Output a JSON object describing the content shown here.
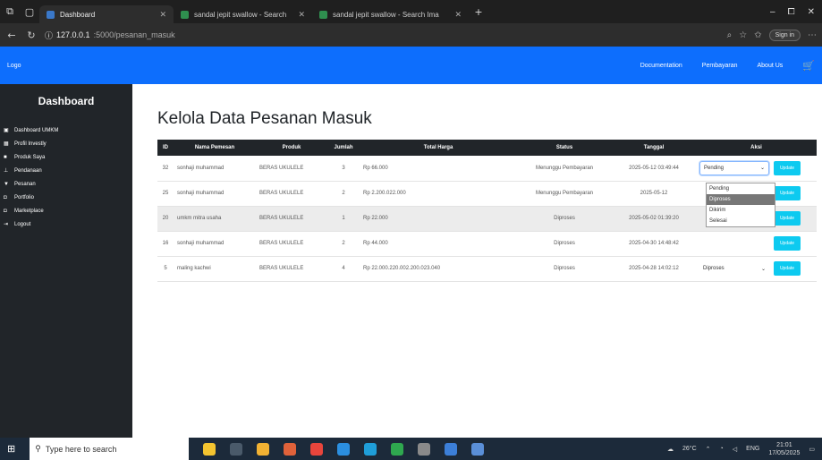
{
  "browser": {
    "tabs": [
      {
        "label": "Dashboard",
        "active": true
      },
      {
        "label": "sandal jepit swallow - Search",
        "active": false
      },
      {
        "label": "sandal jepit swallow - Search Ima",
        "active": false
      }
    ],
    "new_tab": "+",
    "url_host": "127.0.0.1",
    "url_path": ":5000/pesanan_masuk",
    "signin_label": "Sign in"
  },
  "navbar": {
    "brand": "Logo",
    "links": [
      "Documentation",
      "Pembayaran",
      "About Us"
    ]
  },
  "sidebar": {
    "title": "Dashboard",
    "items": [
      {
        "icon": "▣",
        "label": "Dashboard UMKM"
      },
      {
        "icon": "▦",
        "label": "Profil Investly"
      },
      {
        "icon": "■",
        "label": "Produk Saya"
      },
      {
        "icon": "⊥",
        "label": "Pendanaan"
      },
      {
        "icon": "▼",
        "label": "Pesanan"
      },
      {
        "icon": "◘",
        "label": "Portfolio"
      },
      {
        "icon": "◘",
        "label": "Marketplace"
      },
      {
        "icon": "⇥",
        "label": "Logout"
      }
    ]
  },
  "page": {
    "title": "Kelola Data Pesanan Masuk",
    "columns": [
      "ID",
      "Nama Pemesan",
      "Produk",
      "Jumlah",
      "Total Harga",
      "Status",
      "Tanggal",
      "Aksi"
    ],
    "rows": [
      {
        "id": "32",
        "nama": "sonhaji muhammad",
        "produk": "BERAS UKULELE",
        "jumlah": "3",
        "harga": "Rp 66.000",
        "status": "Menunggu Pembayaran",
        "tanggal": "2025-05-12 03:49:44",
        "aksi": "Pending"
      },
      {
        "id": "25",
        "nama": "sonhaji muhammad",
        "produk": "BERAS UKULELE",
        "jumlah": "2",
        "harga": "Rp 2.200.022.000",
        "status": "Menunggu Pembayaran",
        "tanggal": "2025-05-12",
        "aksi": ""
      },
      {
        "id": "20",
        "nama": "umkm mitra usaha",
        "produk": "BERAS UKULELE",
        "jumlah": "1",
        "harga": "Rp 22.000",
        "status": "Diproses",
        "tanggal": "2025-05-02 01:39:20",
        "aksi": ""
      },
      {
        "id": "16",
        "nama": "sonhaji muhammad",
        "produk": "BERAS UKULELE",
        "jumlah": "2",
        "harga": "Rp 44.000",
        "status": "Diproses",
        "tanggal": "2025-04-30 14:48:42",
        "aksi": ""
      },
      {
        "id": "5",
        "nama": "maling kachwi",
        "produk": "BERAS UKULELE",
        "jumlah": "4",
        "harga": "Rp 22.000.220.002.200.023.040",
        "status": "Diproses",
        "tanggal": "2025-04-28 14:02:12",
        "aksi": "Diproses"
      }
    ],
    "update_label": "Update",
    "dropdown_options": [
      "Pending",
      "Diproses",
      "Dikirim",
      "Selesai"
    ],
    "dropdown_selected_index": 1
  },
  "taskbar": {
    "search_placeholder": "Type here to search",
    "weather": "26°C",
    "lang": "ENG",
    "time": "21:01",
    "date": "17/05/2025"
  },
  "colors": {
    "navbar": "#0d6efd",
    "sidebar": "#212529",
    "update_button": "#0dcaf0"
  }
}
